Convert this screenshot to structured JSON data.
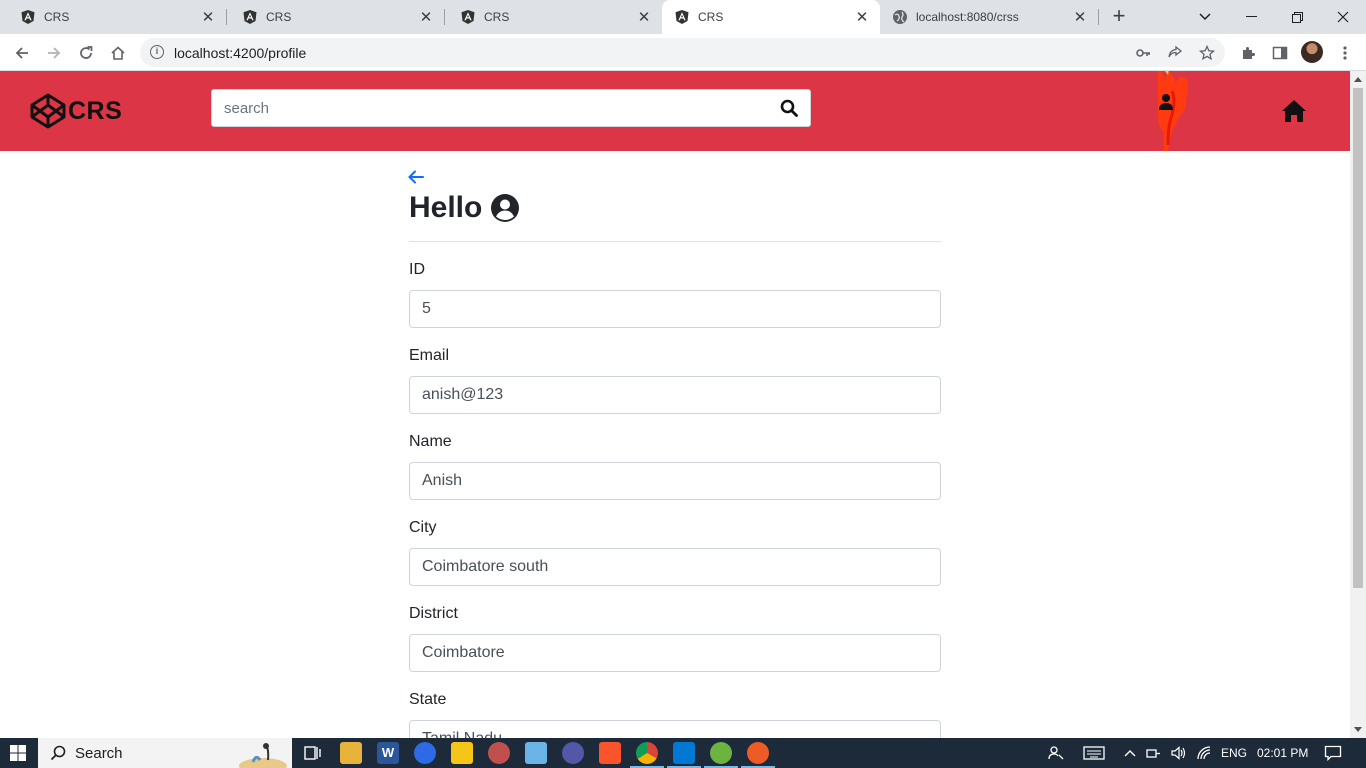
{
  "browser": {
    "tabs": [
      {
        "title": "CRS",
        "favicon": "angular-icon",
        "active": false
      },
      {
        "title": "CRS",
        "favicon": "angular-icon",
        "active": false
      },
      {
        "title": "CRS",
        "favicon": "angular-icon",
        "active": false
      },
      {
        "title": "CRS",
        "favicon": "angular-icon",
        "active": true
      },
      {
        "title": "localhost:8080/crss",
        "favicon": "globe-icon",
        "active": false
      }
    ],
    "url": "localhost:4200/profile"
  },
  "navbar": {
    "brand": "CRS",
    "search_placeholder": "search",
    "color": "#dc3545"
  },
  "page": {
    "greeting": "Hello",
    "fields": [
      {
        "label": "ID",
        "value": "5"
      },
      {
        "label": "Email",
        "value": "anish@123"
      },
      {
        "label": "Name",
        "value": "Anish"
      },
      {
        "label": "City",
        "value": "Coimbatore south"
      },
      {
        "label": "District",
        "value": "Coimbatore"
      },
      {
        "label": "State",
        "value": "Tamil Nadu"
      }
    ]
  },
  "taskbar": {
    "search_label": "Search",
    "language": "ENG",
    "time": "02:01 PM"
  }
}
